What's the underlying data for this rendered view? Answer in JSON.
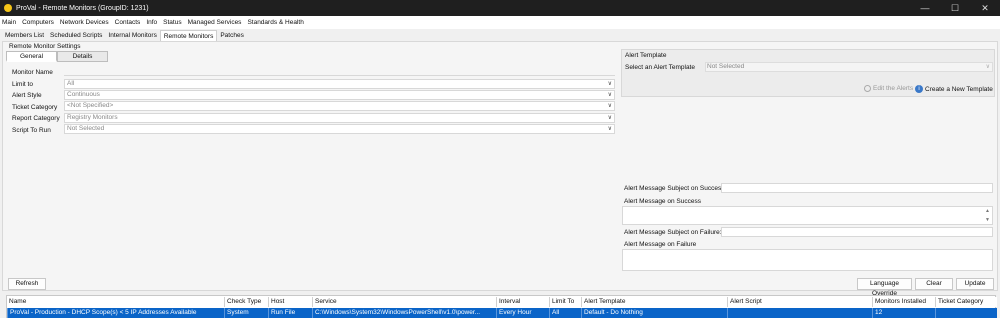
{
  "window": {
    "title": "ProVal - Remote Monitors   (GroupID: 1231)"
  },
  "window_controls": {
    "minimize": "—",
    "maximize": "☐",
    "close": "✕"
  },
  "menu": [
    "Main",
    "Computers",
    "Network Devices",
    "Contacts",
    "Info",
    "Status",
    "Managed Services",
    "Standards & Health"
  ],
  "tabs": [
    "Members List",
    "Scheduled Scripts",
    "Internal Monitors",
    "Remote Monitors",
    "Patches"
  ],
  "active_tab": "Remote Monitors",
  "section_title": "Remote Monitor Settings",
  "subtabs": [
    "General",
    "Details"
  ],
  "form": {
    "monitor_name_label": "Monitor Name",
    "monitor_name_value": "",
    "limit_to_label": "Limit to",
    "limit_to_value": "All",
    "alert_style_label": "Alert Style",
    "alert_style_value": "Continuous",
    "ticket_category_label": "Ticket Category",
    "ticket_category_value": "<Not Specified>",
    "report_category_label": "Report Category",
    "report_category_value": "Registry Monitors",
    "script_label": "Script To Run",
    "script_value": "Not Selected"
  },
  "alert_template": {
    "title": "Alert Template",
    "select_label": "Select an Alert Template",
    "select_value": "Not Selected",
    "edit_label": "Edit the Alerts",
    "create_label": "Create a New Template"
  },
  "alert_messages": {
    "subject_success_label": "Alert Message Subject on Success:",
    "message_success_label": "Alert Message on Success",
    "subject_failure_label": "Alert Message Subject on Failure:",
    "message_failure_label": "Alert Message on Failure"
  },
  "buttons": {
    "refresh": "Refresh",
    "language_override": "Language Override",
    "clear": "Clear",
    "update": "Update"
  },
  "grid": {
    "columns": [
      "Name",
      "Check Type",
      "Host",
      "Service",
      "Interval",
      "Limit To",
      "Alert Template",
      "Alert Script",
      "Monitors Installed",
      "Ticket Category"
    ],
    "rows": [
      [
        "ProVal - Production - DHCP Scope(s) < 5 IP Addresses Available",
        "System",
        "Run File",
        "C:\\Windows\\System32\\WindowsPowerShell\\v1.0\\power...",
        "Every Hour",
        "All",
        "Default - Do Nothing",
        "",
        "12",
        ""
      ]
    ]
  }
}
